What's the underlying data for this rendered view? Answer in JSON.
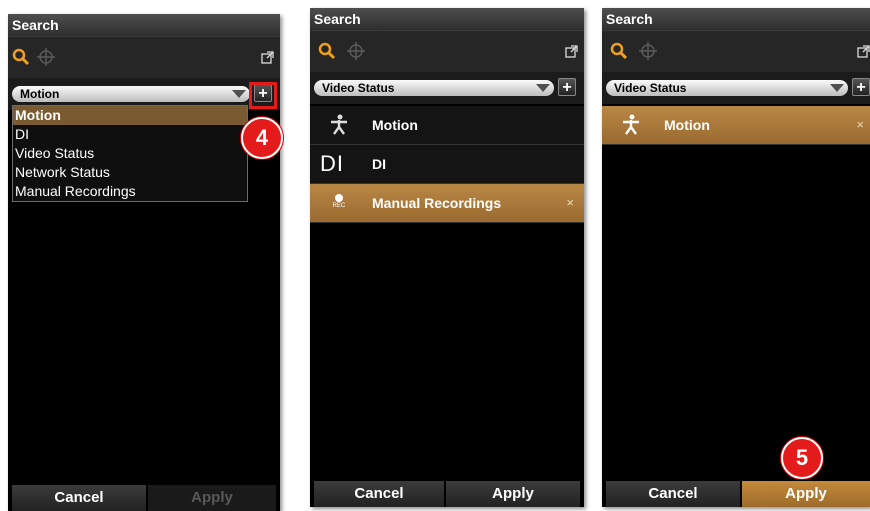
{
  "panel1": {
    "title": "Search",
    "combo_value": "Motion",
    "add_label": "+",
    "dropdown": [
      "Motion",
      "DI",
      "Video Status",
      "Network Status",
      "Manual Recordings"
    ],
    "selected_index": 0,
    "cancel_label": "Cancel",
    "apply_label": "Apply",
    "callout": "4"
  },
  "panel2": {
    "title": "Search",
    "combo_value": "Video Status",
    "add_label": "+",
    "rows": [
      {
        "icon": "motion-icon",
        "label": "Motion",
        "active": false
      },
      {
        "icon": "di-icon",
        "glyph": "DI",
        "label": "DI",
        "active": false
      },
      {
        "icon": "rec-icon",
        "glyph": "REC",
        "label": "Manual Recordings",
        "active": true,
        "remove": "×"
      }
    ],
    "cancel_label": "Cancel",
    "apply_label": "Apply"
  },
  "panel3": {
    "title": "Search",
    "combo_value": "Video Status",
    "add_label": "+",
    "rows": [
      {
        "icon": "motion-icon",
        "label": "Motion",
        "active": true,
        "remove": "×"
      }
    ],
    "cancel_label": "Cancel",
    "apply_label": "Apply",
    "callout": "5"
  },
  "colors": {
    "accent": "#b98745",
    "callout": "#e31b1b",
    "panel_bg": "#000000"
  }
}
